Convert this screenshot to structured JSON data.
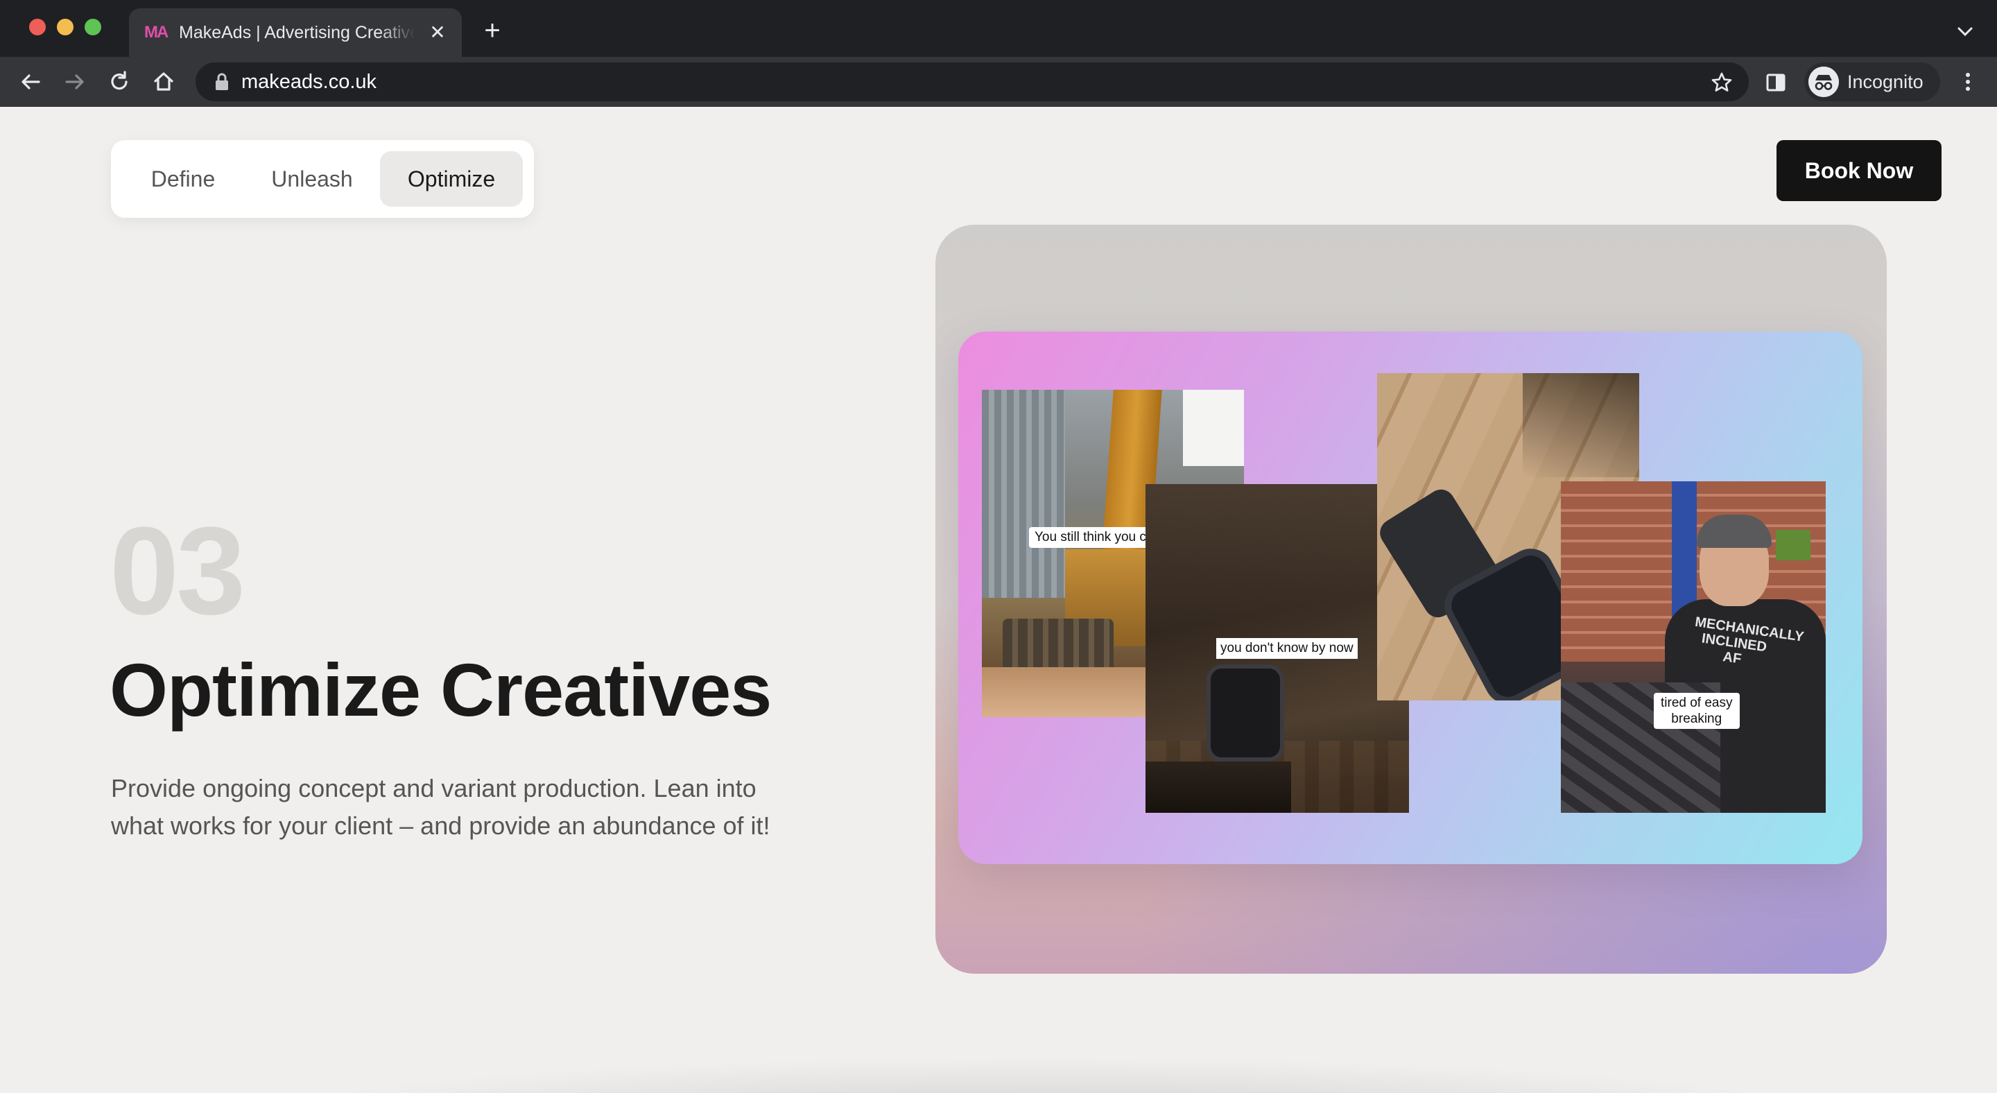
{
  "browser": {
    "tab_title": "MakeAds | Advertising Creative",
    "favicon_text": "MA",
    "url": "makeads.co.uk",
    "profile_label": "Incognito",
    "icons": [
      "back-icon",
      "forward-icon",
      "reload-icon",
      "home-icon",
      "lock-icon",
      "star-icon",
      "side-panel-icon",
      "incognito-icon",
      "menu-icon",
      "close-icon",
      "plus-icon",
      "chevron-down-icon"
    ]
  },
  "nav": {
    "steps": [
      {
        "label": "Define"
      },
      {
        "label": "Unleash"
      },
      {
        "label": "Optimize",
        "active": true
      }
    ],
    "cta": "Book Now"
  },
  "section": {
    "number": "03",
    "title": "Optimize Creatives",
    "description": "Provide ongoing concept and variant production. Lean into what works for your client – and provide an abundance of it!"
  },
  "showcase": {
    "captions": [
      "You still think you can't",
      "you don't know by now",
      "tired of easy\nbreaking"
    ],
    "shirt_text": "MECHANICALLY INCLINED AF"
  },
  "colors": {
    "page_bg": "#f1efed",
    "cta_bg": "#141414",
    "gradient_start": "#ec8de0",
    "gradient_end": "#96e6f1"
  }
}
